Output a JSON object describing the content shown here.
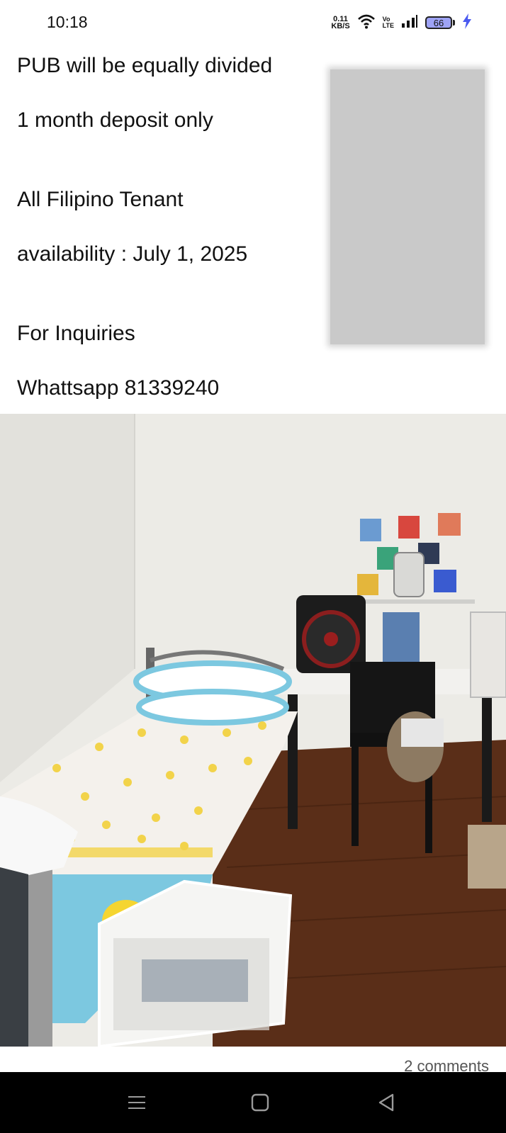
{
  "status_bar": {
    "time": "10:18",
    "net_speed_value": "0.11",
    "net_speed_unit": "KB/S",
    "volte_top": "Vo",
    "volte_bottom": "LTE",
    "battery_level": "66",
    "icons": [
      "wifi-icon",
      "signal-icon",
      "battery-icon",
      "charging-icon"
    ]
  },
  "post": {
    "lines": [
      "PUB will be equally divided",
      "1 month deposit only",
      "All Filipino Tenant",
      "availability : July 1, 2025",
      "For Inquiries",
      "Whattsapp 81339240"
    ]
  },
  "photo": {
    "subject": "room-photo"
  },
  "footer": {
    "comments_count": "2 comments"
  },
  "nav_bar": {
    "icons": [
      "menu-icon",
      "home-icon",
      "back-icon"
    ]
  },
  "colors": {
    "wall": "#ecebe6",
    "floor": "#5a2e18",
    "bed_sheet": "#f4f1ec",
    "blue_accent": "#7cc8e0",
    "nav_background": "#000000"
  }
}
